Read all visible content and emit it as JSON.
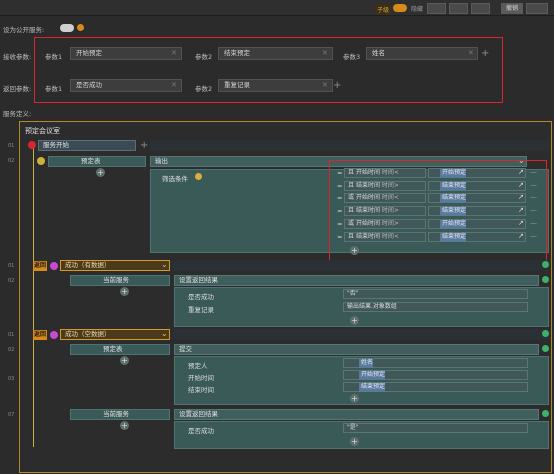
{
  "topbar": {
    "toggle_label": "子级",
    "right_label": "隐藏",
    "buttons": [
      "",
      "",
      "",
      ""
    ],
    "active_button": "撤销"
  },
  "settings": {
    "public_label": "设为公开服务",
    "receive_label": "接收参数",
    "return_label": "返回参数",
    "definition_label": "服务定义"
  },
  "receive_params": [
    {
      "label": "参数1",
      "value": "开始预定"
    },
    {
      "label": "参数2",
      "value": "结束预定"
    },
    {
      "label": "参数3",
      "value": "姓名"
    }
  ],
  "return_params": [
    {
      "label": "参数1",
      "value": "是否成功"
    },
    {
      "label": "参数2",
      "value": "重复记录"
    }
  ],
  "flow": {
    "title": "预定会议室",
    "start_label": "服务开始",
    "reserve_table": "预定表",
    "output_label": "输出",
    "filter_label": "筛选条件",
    "filter_rows": [
      {
        "op": "且",
        "field": "开始时间",
        "cmp": "时间<",
        "value": "开始预定"
      },
      {
        "op": "且",
        "field": "结束时间",
        "cmp": "时间>",
        "value": "结束预定"
      },
      {
        "op": "或",
        "field": "开始时间",
        "cmp": "时间<",
        "value": "结束预定"
      },
      {
        "op": "且",
        "field": "结束时间",
        "cmp": "时间>",
        "value": "结束预定"
      },
      {
        "op": "或",
        "field": "开始时间",
        "cmp": "时间>",
        "value": "开始预定"
      },
      {
        "op": "且",
        "field": "结束时间",
        "cmp": "时间<",
        "value": "结束预定"
      }
    ],
    "branch1": {
      "badge": "返回",
      "label": "成功（有数据）",
      "current_service": "当前服务",
      "action": "设置返回结果",
      "rows": [
        {
          "name": "是否成功",
          "value": "\"否\""
        },
        {
          "name": "重复记录",
          "value": "输出结果.对象数组"
        }
      ]
    },
    "branch2": {
      "badge": "返回",
      "label": "成功（空数据）",
      "table": "预定表",
      "action": "提交",
      "rows": [
        {
          "name": "预定人",
          "value": "姓名"
        },
        {
          "name": "开始时间",
          "value": "开始预定"
        },
        {
          "name": "结束时间",
          "value": "结束预定"
        }
      ],
      "current_service": "当前服务",
      "action2": "设置返回结果",
      "row2": {
        "name": "是否成功",
        "value": "\"是\""
      }
    },
    "line_numbers": [
      "01",
      "02",
      "01",
      "02",
      "01",
      "02",
      "03",
      "07"
    ]
  },
  "colors": {
    "red_box": "#d8262e",
    "orange": "#d58a1a",
    "teal": "#3f5e5c"
  }
}
